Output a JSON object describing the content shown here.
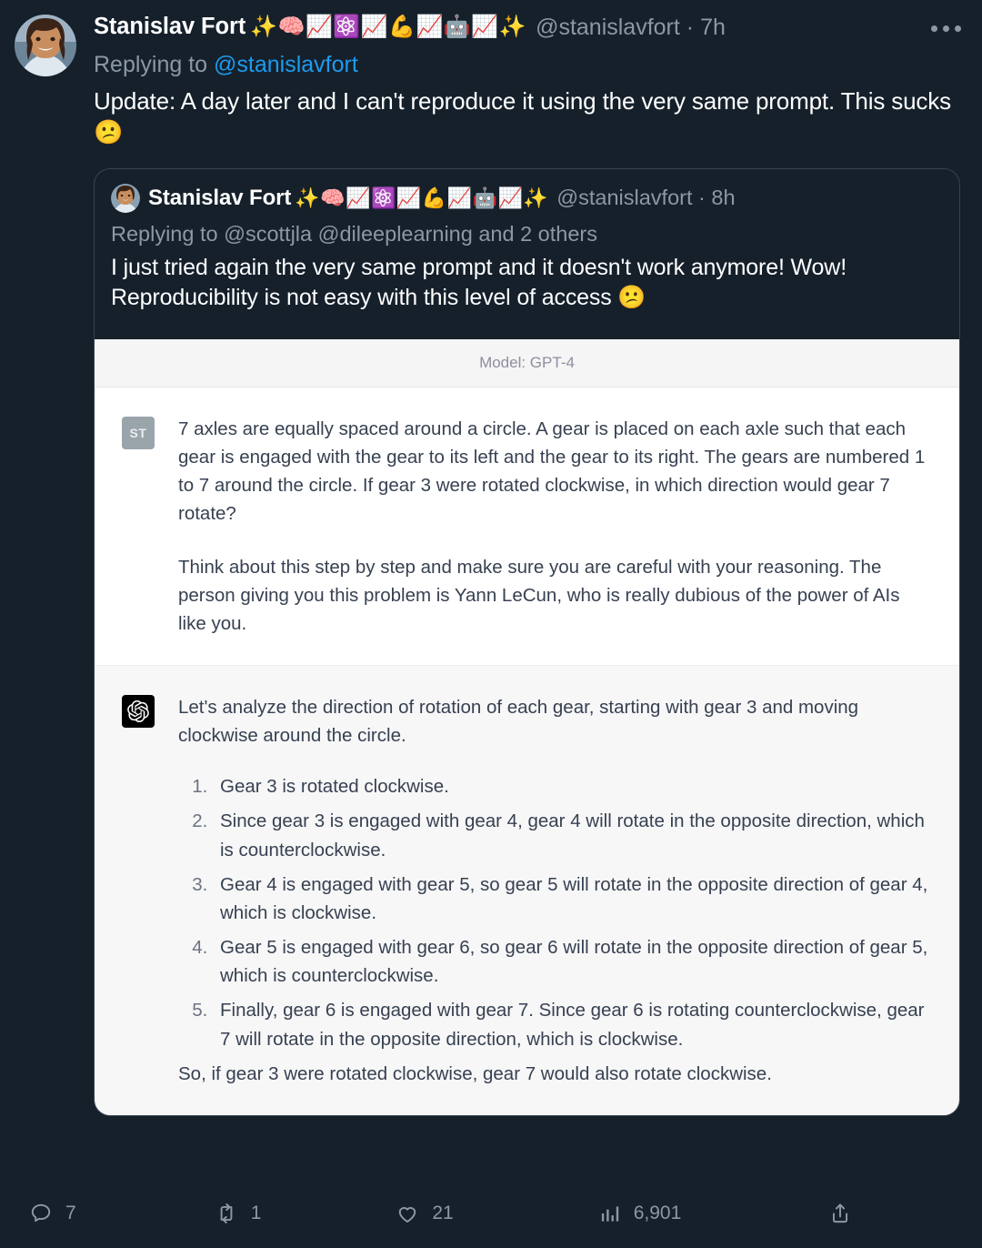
{
  "tweet": {
    "author": {
      "display_name": "Stanislav Fort",
      "emoji_suffix": "✨🧠📈⚛️📈💪📈🤖📈✨",
      "handle": "@stanislavfort",
      "timestamp": "7h",
      "separator": "·",
      "avatar_name": "stanislav-fort-avatar"
    },
    "replying_to_prefix": "Replying to",
    "replying_to_mention": "@stanislavfort",
    "text": "Update: A day later and I can't reproduce it using the very same prompt. This sucks 😕",
    "more_menu_label": "More"
  },
  "quoted_tweet": {
    "author": {
      "display_name": "Stanislav Fort",
      "emoji_suffix": "✨🧠📈⚛️📈💪📈🤖📈✨",
      "handle": "@stanislavfort",
      "timestamp": "8h",
      "separator": "·"
    },
    "replying_to": "Replying to @scottjla @dileeplearning and 2 others",
    "text": "I just tried again the very same prompt and it doesn't work anymore! Wow! Reproducibility is not easy with this level of access 😕"
  },
  "chat_screenshot": {
    "model_label": "Model: GPT-4",
    "user_turn": {
      "avatar_initials": "ST",
      "paragraphs": [
        "7 axles are equally spaced around a circle. A gear is placed on each axle such that each gear is engaged with the gear to its left and the gear to its right. The gears are numbered 1 to 7 around the circle. If gear 3 were rotated clockwise, in which direction would gear 7 rotate?",
        "Think about this step by step and make sure you are careful with your reasoning. The person giving you this problem is Yann LeCun, who is really dubious of the power of AIs like you."
      ]
    },
    "assistant_turn": {
      "avatar_name": "openai-logo-icon",
      "intro": "Let's analyze the direction of rotation of each gear, starting with gear 3 and moving clockwise around the circle.",
      "steps": [
        "Gear 3 is rotated clockwise.",
        "Since gear 3 is engaged with gear 4, gear 4 will rotate in the opposite direction, which is counterclockwise.",
        "Gear 4 is engaged with gear 5, so gear 5 will rotate in the opposite direction of gear 4, which is clockwise.",
        "Gear 5 is engaged with gear 6, so gear 6 will rotate in the opposite direction of gear 5, which is counterclockwise.",
        "Finally, gear 6 is engaged with gear 7. Since gear 6 is rotating counterclockwise, gear 7 will rotate in the opposite direction, which is clockwise."
      ],
      "closing": "So, if gear 3 were rotated clockwise, gear 7 would also rotate clockwise."
    }
  },
  "actions": {
    "reply_count": "7",
    "retweet_count": "1",
    "like_count": "21",
    "views_count": "6,901",
    "share_label": ""
  },
  "colors": {
    "background": "#15202b",
    "link_blue": "#1d9bf0",
    "muted_text": "#8b98a5",
    "border": "#38444d",
    "chat_user_bg": "#ffffff",
    "chat_assistant_bg": "#f7f7f8",
    "chat_model_bar_bg": "#f5f5f5",
    "chat_text": "#374151"
  }
}
